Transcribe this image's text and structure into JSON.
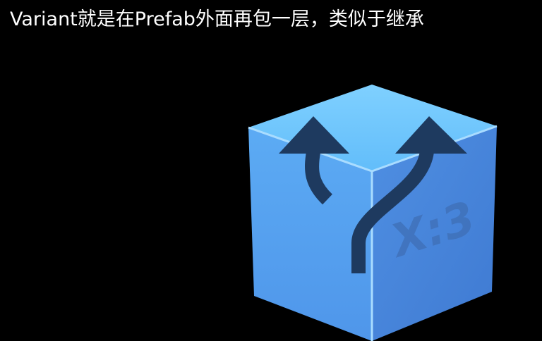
{
  "slide": {
    "title": "Variant就是在Prefab外面再包一层，类似于继承"
  },
  "illustration": {
    "icon": "prefab-variant-cube-icon",
    "cube_label": "X:3",
    "colors": {
      "background": "#000000",
      "cube_top": "#67c3fb",
      "cube_left": "#5aa3f1",
      "cube_right": "#4a87dd",
      "edge_highlight": "#a9dcff",
      "arrows": "#1e3a5f",
      "label": "#3f6fb6"
    }
  }
}
